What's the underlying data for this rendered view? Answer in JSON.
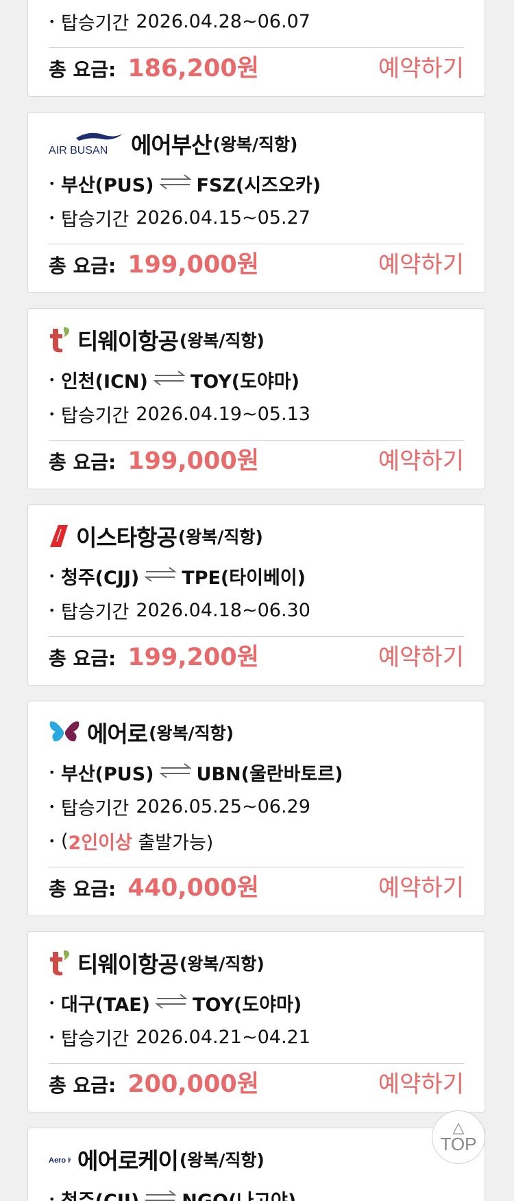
{
  "cards": [
    {
      "airline": "",
      "type": "",
      "route": {
        "from": "",
        "to": ""
      },
      "period_label": "탑승기간",
      "period": "2026.04.28~06.07",
      "price_label": "총 요금:",
      "price": "186,200원",
      "reserve_label": "예약하기"
    },
    {
      "logo": "air-busan-logo",
      "logo_text": "AIR BUSAN",
      "airline": "에어부산",
      "type": "(왕복/직항)",
      "route": {
        "from": "부산(PUS)",
        "to": "FSZ(시즈오카)"
      },
      "period_label": "탑승기간",
      "period": "2026.04.15~05.27",
      "price_label": "총 요금:",
      "price": "199,000원",
      "reserve_label": "예약하기"
    },
    {
      "logo": "tway-logo",
      "airline": "티웨이항공",
      "type": "(왕복/직항)",
      "route": {
        "from": "인천(ICN)",
        "to": "TOY(도야마)"
      },
      "period_label": "탑승기간",
      "period": "2026.04.19~05.13",
      "price_label": "총 요금:",
      "price": "199,000원",
      "reserve_label": "예약하기"
    },
    {
      "logo": "eastar-jet-logo",
      "airline": "이스타항공",
      "type": "(왕복/직항)",
      "route": {
        "from": "청주(CJJ)",
        "to": "TPE(타이베이)"
      },
      "period_label": "탑승기간",
      "period": "2026.04.18~06.30",
      "price_label": "총 요금:",
      "price": "199,200원",
      "reserve_label": "예약하기"
    },
    {
      "logo": "mongolian-butterfly-logo",
      "airline": "에어로",
      "type": "(왕복/직항)",
      "route": {
        "from": "부산(PUS)",
        "to": "UBN(울란바토르)"
      },
      "period_label": "탑승기간",
      "period": "2026.05.25~06.29",
      "note_open": "(",
      "note_highlight": "2인이상",
      "note_rest": " 출발가능)",
      "price_label": "총 요금:",
      "price": "440,000원",
      "reserve_label": "예약하기"
    },
    {
      "logo": "tway-logo",
      "airline": "티웨이항공",
      "type": "(왕복/직항)",
      "route": {
        "from": "대구(TAE)",
        "to": "TOY(도야마)"
      },
      "period_label": "탑승기간",
      "period": "2026.04.21~04.21",
      "price_label": "총 요금:",
      "price": "200,000원",
      "reserve_label": "예약하기"
    },
    {
      "logo": "aero-k-logo",
      "logo_text": "Aero K",
      "airline": "에어로케이",
      "type": "(왕복/직항)",
      "route": {
        "from": "청주(CJJ)",
        "to": "NGO(나고야)"
      }
    }
  ],
  "top_button": {
    "label": "TOP",
    "icon": "triangle-up-icon"
  },
  "colors": {
    "accent": "#e86a6a",
    "background": "#f0f0f0",
    "card": "#ffffff"
  }
}
